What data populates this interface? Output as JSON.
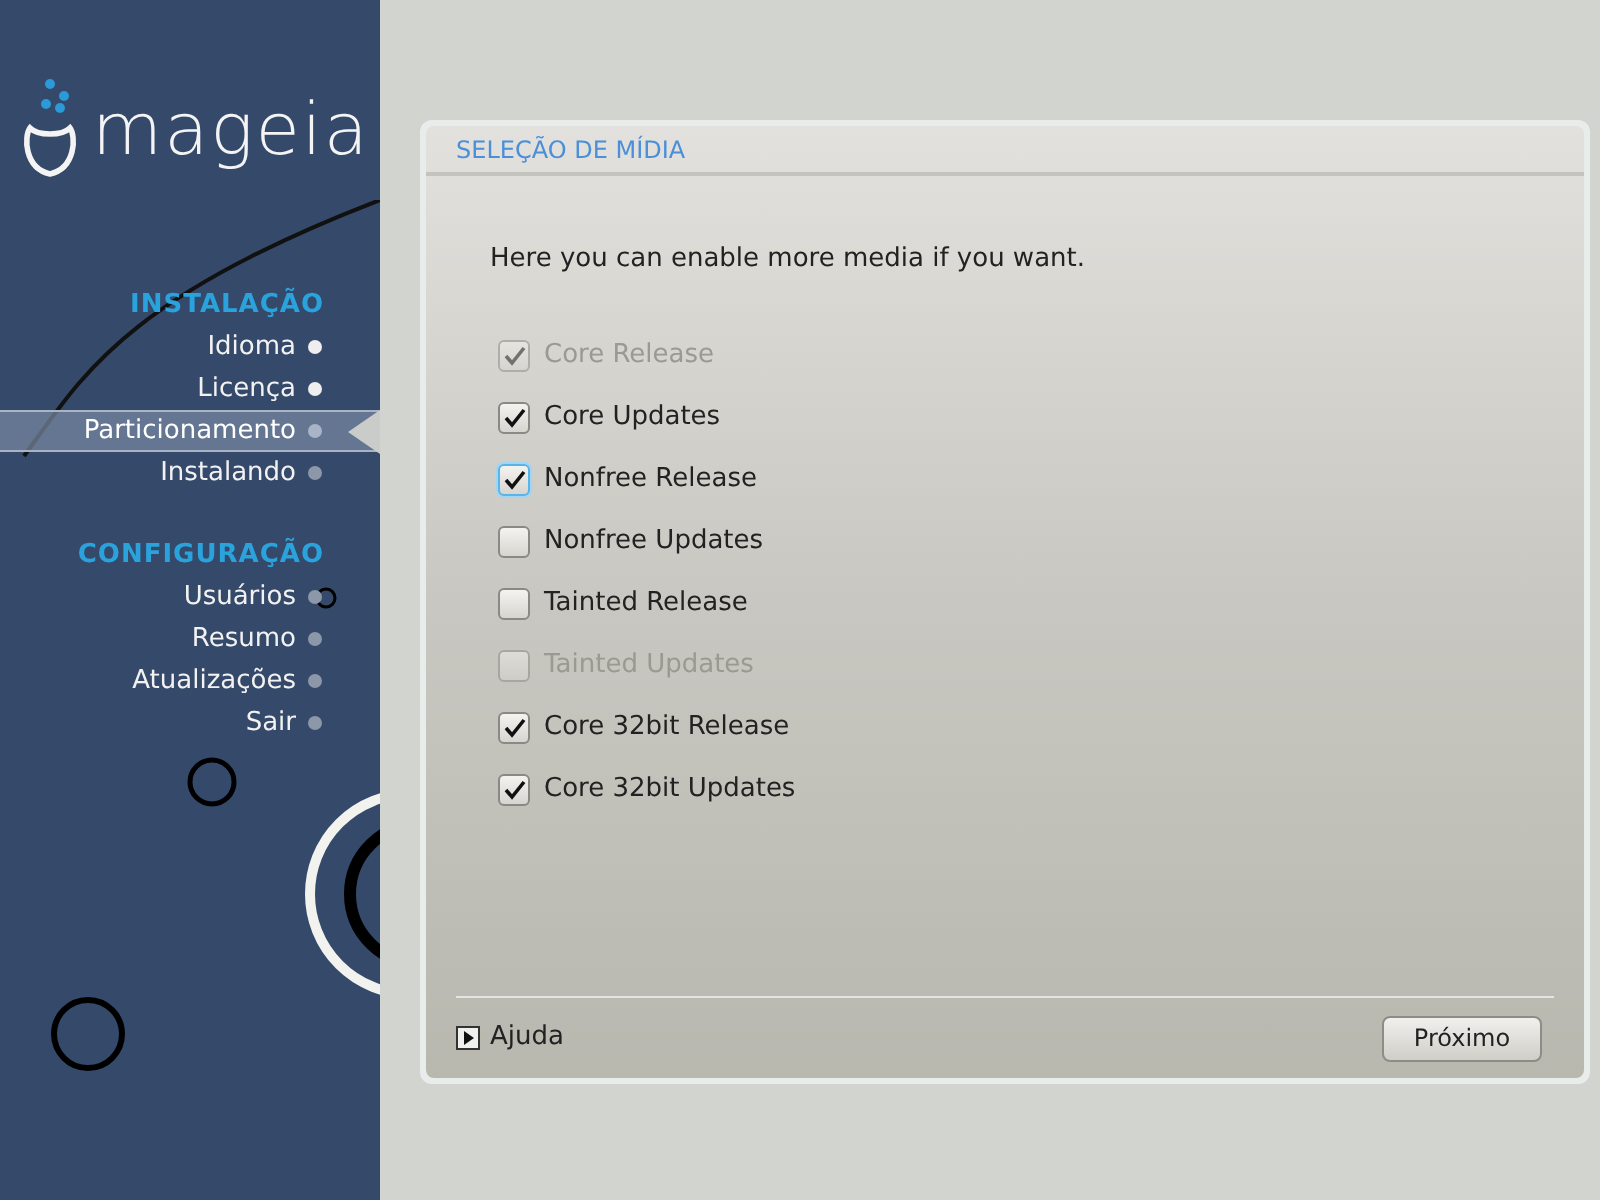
{
  "logo": {
    "text": "mageia"
  },
  "sidebar": {
    "sections": [
      {
        "title": "INSTALAÇÃO",
        "items": [
          {
            "label": "Idioma",
            "selected": false,
            "done": true
          },
          {
            "label": "Licença",
            "selected": false,
            "done": true
          },
          {
            "label": "Particionamento",
            "selected": true,
            "done": false
          },
          {
            "label": "Instalando",
            "selected": false,
            "done": false
          }
        ]
      },
      {
        "title": "CONFIGURAÇÃO",
        "items": [
          {
            "label": "Usuários",
            "selected": false,
            "done": false
          },
          {
            "label": "Resumo",
            "selected": false,
            "done": false
          },
          {
            "label": "Atualizações",
            "selected": false,
            "done": false
          },
          {
            "label": "Sair",
            "selected": false,
            "done": false
          }
        ]
      }
    ]
  },
  "panel": {
    "title": "SELEÇÃO DE MÍDIA",
    "description": "Here you can enable more media if you want.",
    "media": [
      {
        "label": "Core Release",
        "checked": true,
        "disabled": true,
        "focused": false
      },
      {
        "label": "Core Updates",
        "checked": true,
        "disabled": false,
        "focused": false
      },
      {
        "label": "Nonfree Release",
        "checked": true,
        "disabled": false,
        "focused": true
      },
      {
        "label": "Nonfree Updates",
        "checked": false,
        "disabled": false,
        "focused": false
      },
      {
        "label": "Tainted Release",
        "checked": false,
        "disabled": false,
        "focused": false
      },
      {
        "label": "Tainted Updates",
        "checked": false,
        "disabled": true,
        "focused": false
      },
      {
        "label": "Core 32bit Release",
        "checked": true,
        "disabled": false,
        "focused": false
      },
      {
        "label": "Core 32bit Updates",
        "checked": true,
        "disabled": false,
        "focused": false
      }
    ],
    "help": "Ajuda",
    "next_button": "Próximo"
  }
}
